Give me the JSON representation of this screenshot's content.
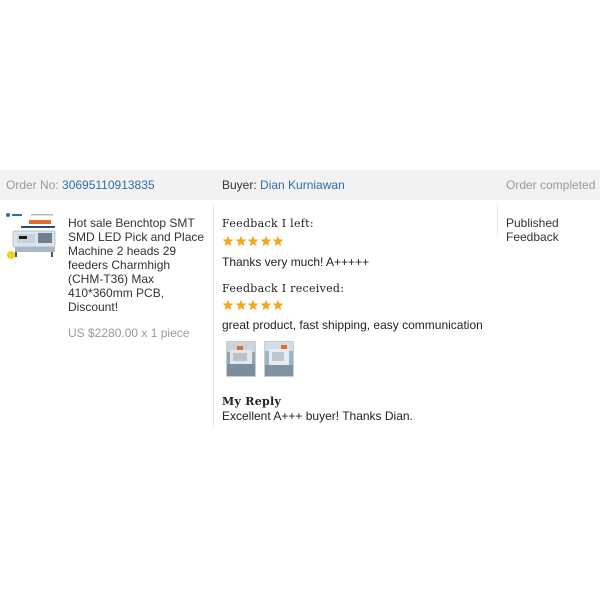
{
  "order": {
    "number_label": "Order No:",
    "number": "30695110913835",
    "buyer_label": "Buyer:",
    "buyer_name": "Dian Kurniawan",
    "status": "Order completed"
  },
  "product": {
    "title": "Hot sale Benchtop SMT SMD LED Pick and Place Machine 2 heads 29 feeders Charmhigh (CHM-T36) Max 410*360mm PCB, Discount!",
    "price": "US $2280.00 x 1 piece",
    "thumbnail_icon": "pick-and-place-machine-image"
  },
  "feedback": {
    "left_label": "Feedback I left:",
    "left_stars": 5,
    "left_text": "Thanks very much! A+++++",
    "received_label": "Feedback I received:",
    "received_stars": 5,
    "received_text": "great product, fast shipping, easy communication",
    "photos": [
      "buyer-photo-1",
      "buyer-photo-2"
    ],
    "reply_label": "My Reply",
    "reply_text": "Excellent A+++ buyer! Thanks Dian."
  },
  "status_cell": {
    "text": "Published Feedback"
  },
  "colors": {
    "star": "#f5a623",
    "link": "#2e6fa7",
    "header_bg": "#f2f2f2",
    "muted": "#999999"
  }
}
